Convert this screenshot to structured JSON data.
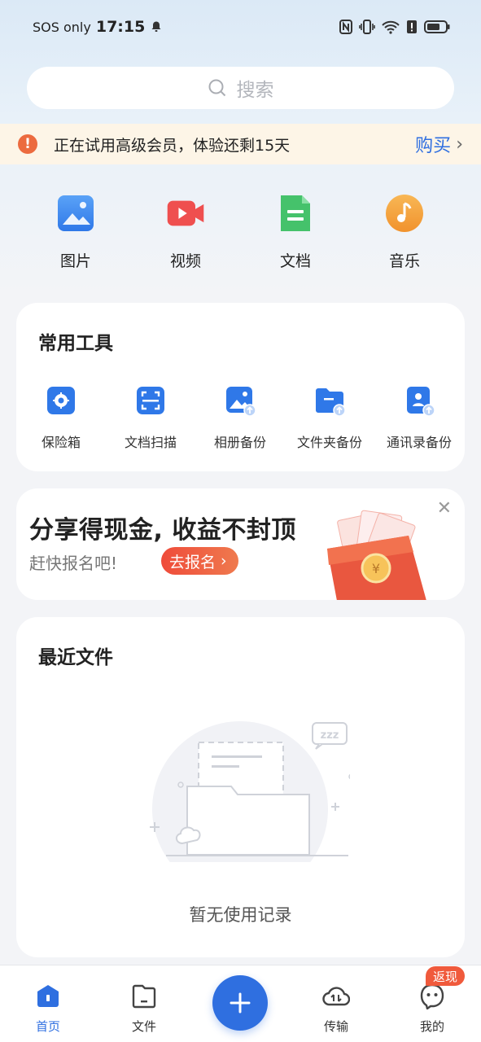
{
  "status_bar": {
    "carrier": "SOS only",
    "time": "17:15",
    "icons": [
      "bell-icon",
      "nfc-icon",
      "vibrate-icon",
      "wifi-icon",
      "alert-icon",
      "battery-icon"
    ]
  },
  "search": {
    "placeholder": "搜索"
  },
  "trial_notice": {
    "text": "正在试用高级会员，体验还剩15天",
    "action": "购买"
  },
  "categories": [
    {
      "label": "图片",
      "icon": "image-icon",
      "color": "#3d8bf2"
    },
    {
      "label": "视频",
      "icon": "video-icon",
      "color": "#ef4f4f"
    },
    {
      "label": "文档",
      "icon": "document-icon",
      "color": "#45c26b"
    },
    {
      "label": "音乐",
      "icon": "music-icon",
      "color": "#f5a13a"
    }
  ],
  "tools": {
    "title": "常用工具",
    "items": [
      {
        "label": "保险箱",
        "icon": "safe-icon"
      },
      {
        "label": "文档扫描",
        "icon": "scan-icon"
      },
      {
        "label": "相册备份",
        "icon": "album-backup-icon"
      },
      {
        "label": "文件夹备份",
        "icon": "folder-backup-icon"
      },
      {
        "label": "通讯录备份",
        "icon": "contacts-backup-icon"
      }
    ]
  },
  "promo": {
    "title": "分享得现金, 收益不封顶",
    "subtitle": "赶快报名吧!",
    "button": "去报名"
  },
  "recent": {
    "title": "最近文件",
    "empty_text": "暂无使用记录"
  },
  "bottom_nav": {
    "items": [
      {
        "label": "首页",
        "icon": "home-icon",
        "active": true
      },
      {
        "label": "文件",
        "icon": "file-icon",
        "active": false
      },
      {
        "label": "传输",
        "icon": "transfer-icon",
        "active": false
      },
      {
        "label": "我的",
        "icon": "profile-icon",
        "active": false
      }
    ],
    "badge": "返现",
    "fab_icon": "plus-icon"
  },
  "colors": {
    "accent": "#2f6fe0",
    "warning": "#ec6b3f",
    "promo": "#ef4b3a"
  }
}
